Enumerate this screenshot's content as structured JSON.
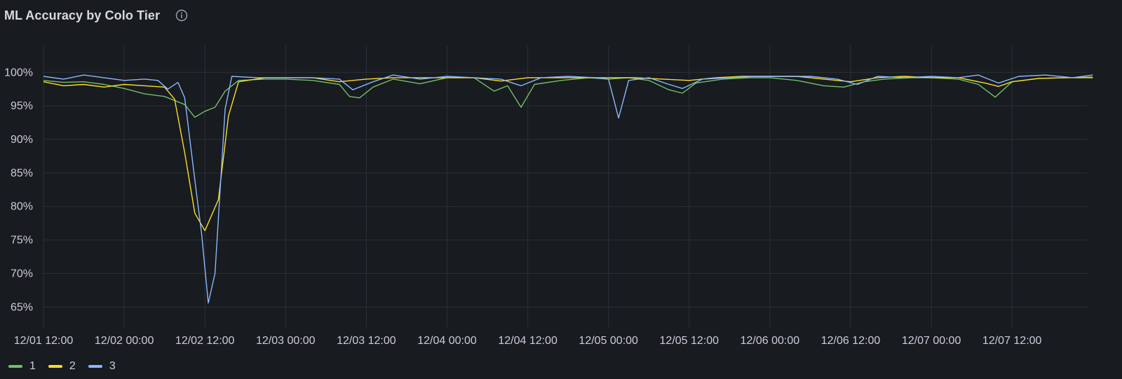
{
  "panel": {
    "title": "ML Accuracy by Colo Tier",
    "info_icon": "info-circle-icon"
  },
  "chart_data": {
    "type": "line",
    "title": "ML Accuracy by Colo Tier",
    "xlabel": "",
    "ylabel": "",
    "x_ticks": [
      "12/01 12:00",
      "12/02 00:00",
      "12/02 12:00",
      "12/03 00:00",
      "12/03 12:00",
      "12/04 00:00",
      "12/04 12:00",
      "12/05 00:00",
      "12/05 12:00",
      "12/06 00:00",
      "12/06 12:00",
      "12/07 00:00",
      "12/07 12:00"
    ],
    "y_ticks": [
      "65%",
      "70%",
      "75%",
      "80%",
      "85%",
      "90%",
      "95%",
      "100%"
    ],
    "ylim": [
      62,
      104
    ],
    "xlim": [
      "12/01 12:00",
      "12/08 00:00"
    ],
    "grid": true,
    "legend_position": "bottom-left",
    "series": [
      {
        "name": "1",
        "color": "#73bf69",
        "points": [
          [
            "12/01 12:00",
            98.8
          ],
          [
            "12/01 15:00",
            98.5
          ],
          [
            "12/01 18:00",
            98.6
          ],
          [
            "12/01 21:00",
            98.2
          ],
          [
            "12/02 00:00",
            97.6
          ],
          [
            "12/02 03:00",
            96.8
          ],
          [
            "12/02 06:00",
            96.4
          ],
          [
            "12/02 09:00",
            95.2
          ],
          [
            "12/02 10:30",
            93.3
          ],
          [
            "12/02 12:00",
            94.2
          ],
          [
            "12/02 13:30",
            94.8
          ],
          [
            "12/02 15:00",
            97.2
          ],
          [
            "12/02 17:00",
            98.8
          ],
          [
            "12/02 21:00",
            99.0
          ],
          [
            "12/03 00:00",
            99.0
          ],
          [
            "12/03 04:00",
            98.8
          ],
          [
            "12/03 08:00",
            98.2
          ],
          [
            "12/03 09:30",
            96.4
          ],
          [
            "12/03 11:00",
            96.2
          ],
          [
            "12/03 13:00",
            97.8
          ],
          [
            "12/03 16:00",
            99.0
          ],
          [
            "12/03 20:00",
            98.3
          ],
          [
            "12/04 00:00",
            99.2
          ],
          [
            "12/04 04:00",
            99.2
          ],
          [
            "12/04 07:00",
            97.2
          ],
          [
            "12/04 09:00",
            98.0
          ],
          [
            "12/04 11:00",
            94.8
          ],
          [
            "12/04 13:00",
            98.2
          ],
          [
            "12/04 17:00",
            98.8
          ],
          [
            "12/04 21:00",
            99.2
          ],
          [
            "12/05 00:00",
            99.0
          ],
          [
            "12/05 03:00",
            99.2
          ],
          [
            "12/05 06:00",
            98.8
          ],
          [
            "12/05 09:00",
            97.4
          ],
          [
            "12/05 11:00",
            96.9
          ],
          [
            "12/05 13:00",
            98.4
          ],
          [
            "12/05 17:00",
            99.0
          ],
          [
            "12/05 21:00",
            99.2
          ],
          [
            "12/06 00:00",
            99.2
          ],
          [
            "12/06 04:00",
            98.8
          ],
          [
            "12/06 08:00",
            98.0
          ],
          [
            "12/06 11:00",
            97.8
          ],
          [
            "12/06 14:00",
            98.6
          ],
          [
            "12/06 17:00",
            99.0
          ],
          [
            "12/06 21:00",
            99.2
          ],
          [
            "12/07 00:00",
            99.2
          ],
          [
            "12/07 04:00",
            99.0
          ],
          [
            "12/07 07:00",
            98.2
          ],
          [
            "12/07 09:30",
            96.3
          ],
          [
            "12/07 12:00",
            98.6
          ],
          [
            "12/07 16:00",
            99.1
          ],
          [
            "12/07 20:00",
            99.2
          ],
          [
            "12/08 00:00",
            99.3
          ]
        ]
      },
      {
        "name": "2",
        "color": "#fade2a",
        "points": [
          [
            "12/01 12:00",
            98.6
          ],
          [
            "12/01 15:00",
            98.0
          ],
          [
            "12/01 18:00",
            98.2
          ],
          [
            "12/01 21:00",
            97.8
          ],
          [
            "12/02 00:00",
            98.2
          ],
          [
            "12/02 03:00",
            98.0
          ],
          [
            "12/02 06:00",
            97.8
          ],
          [
            "12/02 07:30",
            96.0
          ],
          [
            "12/02 09:00",
            88.0
          ],
          [
            "12/02 10:30",
            79.0
          ],
          [
            "12/02 12:00",
            76.4
          ],
          [
            "12/02 14:00",
            81.0
          ],
          [
            "12/02 15:30",
            93.5
          ],
          [
            "12/02 17:00",
            98.6
          ],
          [
            "12/02 21:00",
            99.2
          ],
          [
            "12/03 00:00",
            99.2
          ],
          [
            "12/03 04:00",
            99.2
          ],
          [
            "12/03 08:00",
            98.6
          ],
          [
            "12/03 12:00",
            99.0
          ],
          [
            "12/03 16:00",
            99.2
          ],
          [
            "12/03 20:00",
            99.2
          ],
          [
            "12/04 00:00",
            99.2
          ],
          [
            "12/04 04:00",
            99.2
          ],
          [
            "12/04 08:00",
            98.7
          ],
          [
            "12/04 12:00",
            99.2
          ],
          [
            "12/04 16:00",
            99.2
          ],
          [
            "12/04 20:00",
            99.2
          ],
          [
            "12/05 00:00",
            99.2
          ],
          [
            "12/05 04:00",
            99.2
          ],
          [
            "12/05 08:00",
            99.0
          ],
          [
            "12/05 12:00",
            98.8
          ],
          [
            "12/05 16:00",
            99.2
          ],
          [
            "12/05 20:00",
            99.4
          ],
          [
            "12/06 00:00",
            99.4
          ],
          [
            "12/06 04:00",
            99.4
          ],
          [
            "12/06 08:00",
            99.0
          ],
          [
            "12/06 12:00",
            98.6
          ],
          [
            "12/06 16:00",
            99.2
          ],
          [
            "12/06 20:00",
            99.4
          ],
          [
            "12/07 00:00",
            99.2
          ],
          [
            "12/07 04:00",
            99.2
          ],
          [
            "12/07 08:00",
            98.4
          ],
          [
            "12/07 10:00",
            97.9
          ],
          [
            "12/07 12:00",
            98.6
          ],
          [
            "12/07 16:00",
            99.1
          ],
          [
            "12/07 20:00",
            99.2
          ],
          [
            "12/08 00:00",
            99.2
          ]
        ]
      },
      {
        "name": "3",
        "color": "#8ab8ff",
        "points": [
          [
            "12/01 12:00",
            99.4
          ],
          [
            "12/01 15:00",
            99.0
          ],
          [
            "12/01 18:00",
            99.6
          ],
          [
            "12/01 21:00",
            99.2
          ],
          [
            "12/02 00:00",
            98.8
          ],
          [
            "12/02 03:00",
            99.0
          ],
          [
            "12/02 05:00",
            98.8
          ],
          [
            "12/02 06:30",
            97.5
          ],
          [
            "12/02 08:00",
            98.5
          ],
          [
            "12/02 09:00",
            96.2
          ],
          [
            "12/02 10:30",
            84.0
          ],
          [
            "12/02 11:30",
            76.0
          ],
          [
            "12/02 12:30",
            65.6
          ],
          [
            "12/02 13:30",
            70.0
          ],
          [
            "12/02 15:00",
            94.5
          ],
          [
            "12/02 16:00",
            99.4
          ],
          [
            "12/02 20:00",
            99.2
          ],
          [
            "12/03 00:00",
            99.2
          ],
          [
            "12/03 04:00",
            99.2
          ],
          [
            "12/03 08:00",
            99.0
          ],
          [
            "12/03 10:00",
            97.4
          ],
          [
            "12/03 13:00",
            98.6
          ],
          [
            "12/03 16:00",
            99.6
          ],
          [
            "12/03 20:00",
            99.0
          ],
          [
            "12/04 00:00",
            99.4
          ],
          [
            "12/04 04:00",
            99.2
          ],
          [
            "12/04 08:00",
            99.0
          ],
          [
            "12/04 11:00",
            98.0
          ],
          [
            "12/04 14:00",
            99.2
          ],
          [
            "12/04 18:00",
            99.4
          ],
          [
            "12/04 22:00",
            99.2
          ],
          [
            "12/05 00:00",
            99.0
          ],
          [
            "12/05 01:30",
            93.2
          ],
          [
            "12/05 03:00",
            98.8
          ],
          [
            "12/05 06:00",
            99.2
          ],
          [
            "12/05 09:00",
            98.2
          ],
          [
            "12/05 11:00",
            97.6
          ],
          [
            "12/05 14:00",
            99.0
          ],
          [
            "12/05 18:00",
            99.2
          ],
          [
            "12/05 22:00",
            99.4
          ],
          [
            "12/06 00:00",
            99.4
          ],
          [
            "12/06 06:00",
            99.4
          ],
          [
            "12/06 10:00",
            99.0
          ],
          [
            "12/06 13:00",
            98.2
          ],
          [
            "12/06 16:00",
            99.4
          ],
          [
            "12/06 20:00",
            99.2
          ],
          [
            "12/07 00:00",
            99.4
          ],
          [
            "12/07 04:00",
            99.2
          ],
          [
            "12/07 07:00",
            99.6
          ],
          [
            "12/07 10:00",
            98.4
          ],
          [
            "12/07 13:00",
            99.4
          ],
          [
            "12/07 17:00",
            99.6
          ],
          [
            "12/07 21:00",
            99.2
          ],
          [
            "12/08 00:00",
            99.6
          ]
        ]
      }
    ]
  }
}
